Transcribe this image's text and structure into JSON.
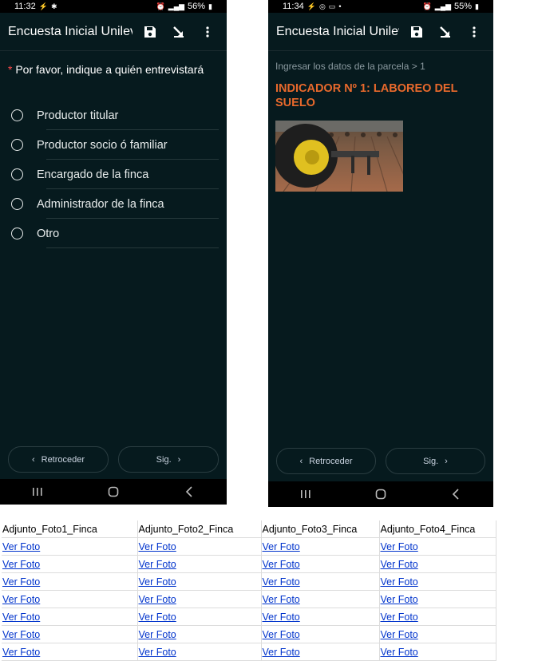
{
  "phone1": {
    "status": {
      "time": "11:32",
      "battery": "56%"
    },
    "title": "Encuesta Inicial Unilev...",
    "question": {
      "required_mark": "*",
      "text": "Por favor, indique a quién entrevistará"
    },
    "options": [
      {
        "label": "Productor titular"
      },
      {
        "label": "Productor socio ó familiar"
      },
      {
        "label": "Encargado de la finca"
      },
      {
        "label": "Administrador de la finca"
      },
      {
        "label": "Otro"
      }
    ],
    "nav": {
      "back": "Retroceder",
      "next": "Sig."
    }
  },
  "phone2": {
    "status": {
      "time": "11:34",
      "battery": "55%"
    },
    "title": "Encuesta Inicial Unilev...",
    "breadcrumb": "Ingresar los datos de la parcela > 1",
    "indicator": "INDICADOR Nº 1: LABOREO DEL SUELO",
    "nav": {
      "back": "Retroceder",
      "next": "Sig."
    }
  },
  "table": {
    "headers": [
      "Adjunto_Foto1_Finca",
      "Adjunto_Foto2_Finca",
      "Adjunto_Foto3_Finca",
      "Adjunto_Foto4_Finca"
    ],
    "rows": [
      [
        "Ver Foto",
        "Ver Foto",
        "Ver Foto",
        "Ver Foto"
      ],
      [
        "Ver Foto",
        "Ver Foto",
        "Ver Foto",
        "Ver Foto"
      ],
      [
        "Ver Foto",
        "Ver Foto",
        "Ver Foto",
        "Ver Foto"
      ],
      [
        "Ver Foto",
        "Ver Foto",
        "Ver Foto",
        "Ver Foto"
      ],
      [
        "Ver Foto",
        "Ver Foto",
        "Ver Foto",
        "Ver Foto"
      ],
      [
        "Ver Foto",
        "Ver Foto",
        "Ver Foto",
        "Ver Foto"
      ],
      [
        "Ver Foto",
        "Ver Foto",
        "Ver Foto",
        "Ver Foto"
      ]
    ]
  },
  "colors": {
    "app_bg": "#061a1e",
    "accent_orange": "#e8692c",
    "required_red": "#ff4b4b",
    "link_blue": "#0033cc"
  }
}
